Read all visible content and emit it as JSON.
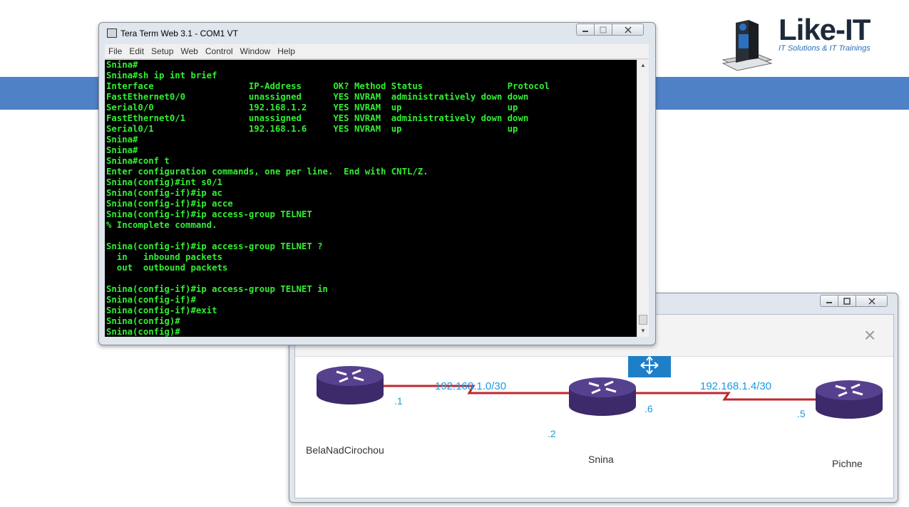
{
  "logo": {
    "name": "Like-IT",
    "tagline": "IT Solutions & IT Trainings"
  },
  "terminal_window": {
    "title": "Tera Term Web 3.1 - COM1 VT",
    "menu": [
      "File",
      "Edit",
      "Setup",
      "Web",
      "Control",
      "Window",
      "Help"
    ],
    "lines": [
      "Snina#",
      "Snina#sh ip int brief",
      "Interface                  IP-Address      OK? Method Status                Protocol",
      "FastEthernet0/0            unassigned      YES NVRAM  administratively down down",
      "Serial0/0                  192.168.1.2     YES NVRAM  up                    up",
      "FastEthernet0/1            unassigned      YES NVRAM  administratively down down",
      "Serial0/1                  192.168.1.6     YES NVRAM  up                    up",
      "Snina#",
      "Snina#",
      "Snina#conf t",
      "Enter configuration commands, one per line.  End with CNTL/Z.",
      "Snina(config)#int s0/1",
      "Snina(config-if)#ip ac",
      "Snina(config-if)#ip acce",
      "Snina(config-if)#ip access-group TELNET",
      "% Incomplete command.",
      "",
      "Snina(config-if)#ip access-group TELNET ?",
      "  in   inbound packets",
      "  out  outbound packets",
      "",
      "Snina(config-if)#ip access-group TELNET in",
      "Snina(config-if)#",
      "Snina(config-if)#exit",
      "Snina(config)#",
      "Snina(config)#"
    ]
  },
  "topology_window": {
    "close_symbol": "×",
    "networks": {
      "left": "192.168.1.0/30",
      "right": "192.168.1.4/30"
    },
    "routers": [
      {
        "name": "BelaNadCirochou",
        "interface_label": ".1"
      },
      {
        "name": "Snina",
        "interface_label_left": ".2",
        "interface_label_right": ".6"
      },
      {
        "name": "Pichne",
        "interface_label": ".5"
      }
    ],
    "colors": {
      "router": "#3c2a6b",
      "link": "#c0282e",
      "ip_label": "#1a9be0"
    }
  }
}
